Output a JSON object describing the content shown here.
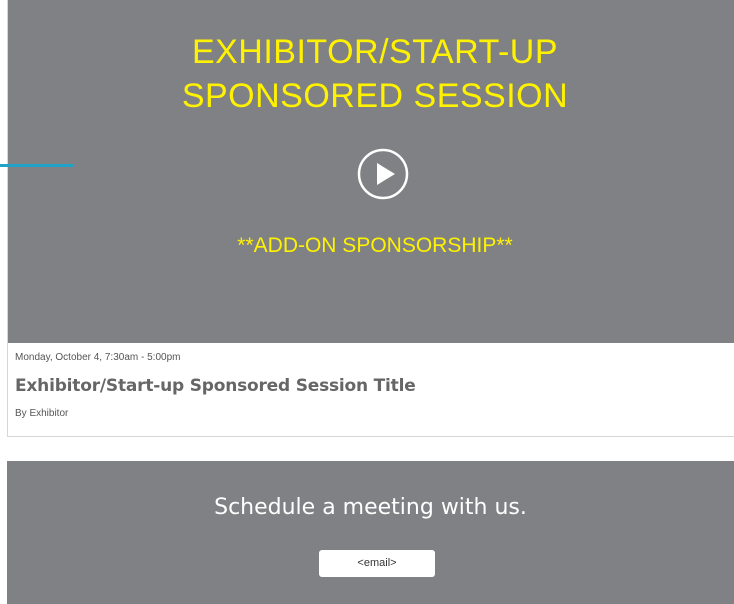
{
  "video": {
    "title_line1": "EXHIBITOR/START-UP",
    "title_line2": "SPONSORED SESSION",
    "subtitle": "**ADD-ON SPONSORSHIP**",
    "title_color": "#fff200",
    "background_color": "#808184",
    "accent_color": "#1fa3c8",
    "play_icon": "play-icon"
  },
  "session": {
    "date": "Monday, October 4, 7:30am - 5:00pm",
    "title": "Exhibitor/Start-up Sponsored Session Title",
    "byline": "By Exhibitor"
  },
  "meeting": {
    "heading": "Schedule a meeting with us.",
    "email_label": "<email>"
  }
}
